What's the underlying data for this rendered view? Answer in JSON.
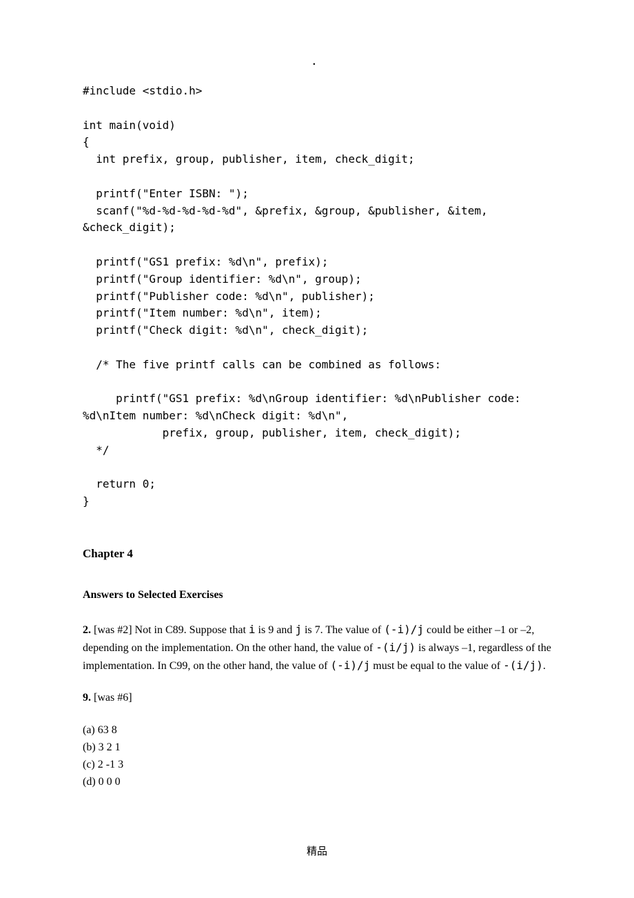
{
  "topDot": "．",
  "code": "#include <stdio.h>\n\nint main(void)\n{\n  int prefix, group, publisher, item, check_digit;\n\n  printf(\"Enter ISBN: \");\n  scanf(\"%d-%d-%d-%d-%d\", &prefix, &group, &publisher, &item, &check_digit);\n\n  printf(\"GS1 prefix: %d\\n\", prefix);\n  printf(\"Group identifier: %d\\n\", group);\n  printf(\"Publisher code: %d\\n\", publisher);\n  printf(\"Item number: %d\\n\", item);\n  printf(\"Check digit: %d\\n\", check_digit);\n\n  /* The five printf calls can be combined as follows:\n\n     printf(\"GS1 prefix: %d\\nGroup identifier: %d\\nPublisher code: %d\\nItem number: %d\\nCheck digit: %d\\n\",\n            prefix, group, publisher, item, check_digit);\n  */\n\n  return 0;\n}",
  "chapter": "Chapter 4",
  "subheading": "Answers to Selected Exercises",
  "exercise2": {
    "label": "2.",
    "tag": " [was #2] ",
    "body_pre": "Not in C89. Suppose that ",
    "i1": "i",
    "t1": " is 9 and ",
    "j1": "j",
    "t2": " is 7. The value of ",
    "e1": "(-i)/j",
    "t3": " could be either –1 or –2, depending on the implementation. On the other hand, the value of ",
    "e2": "-(i/j)",
    "t4": " is always –1, regardless of the implementation. In C99, on the other hand, the value of ",
    "e3": "(-i)/j",
    "t5": " must be equal to the value of ",
    "e4": "-(i/j)",
    "t6": "."
  },
  "exercise9": {
    "label": "9.",
    "tag": " [was #6]"
  },
  "answers": [
    "(a) 63 8",
    "(b) 3 2 1",
    "(c) 2 -1 3",
    "(d) 0 0 0"
  ],
  "footer": "精品"
}
